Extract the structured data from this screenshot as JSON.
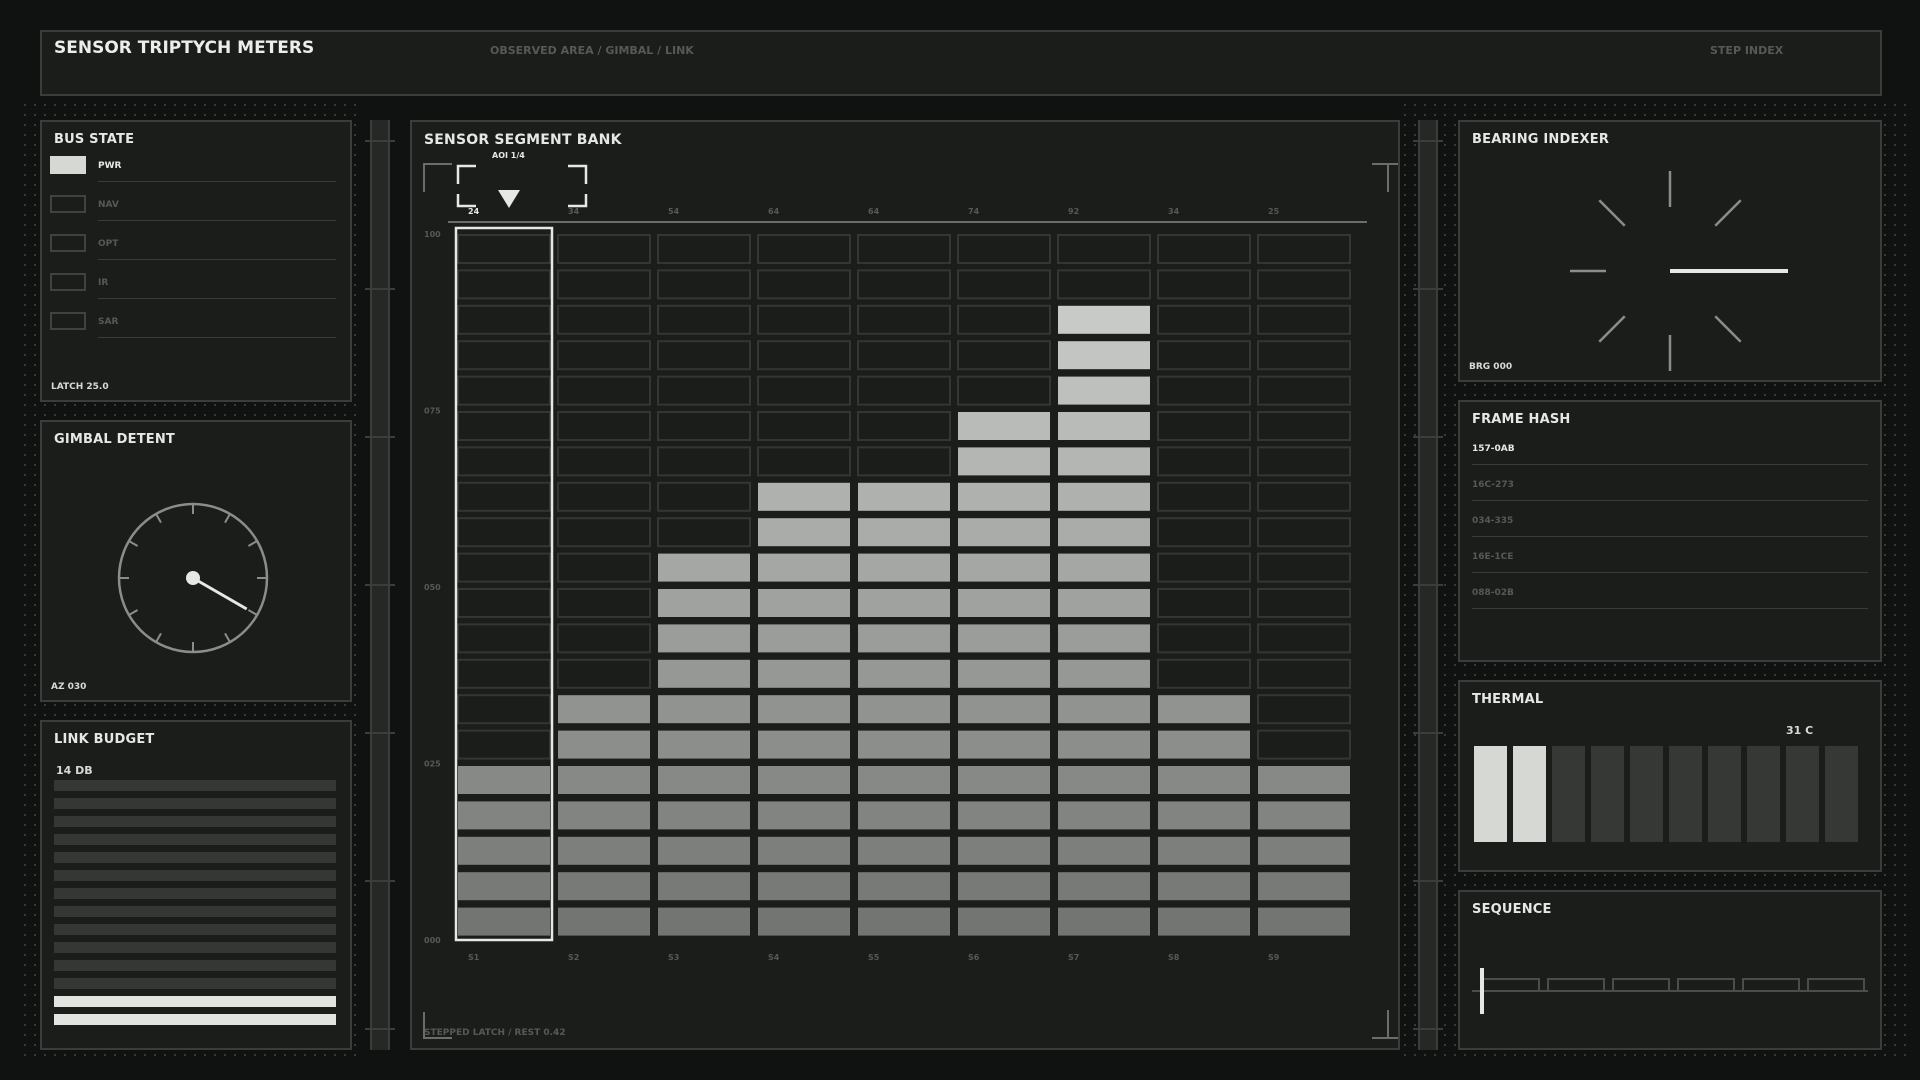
{
  "header": {
    "title": "SENSOR TRIPTYCH METERS",
    "breadcrumb": "OBSERVED AREA / GIMBAL / LINK",
    "right_label": "STEP INDEX"
  },
  "bus_state": {
    "title": "BUS STATE",
    "items": [
      {
        "label": "PWR",
        "active": true
      },
      {
        "label": "NAV",
        "active": false
      },
      {
        "label": "OPT",
        "active": false
      },
      {
        "label": "IR",
        "active": false
      },
      {
        "label": "SAR",
        "active": false
      }
    ],
    "footer": "LATCH 25.0"
  },
  "gimbal": {
    "title": "GIMBAL DETENT",
    "footer": "AZ 030",
    "angle_deg": 120
  },
  "link_budget": {
    "title": "LINK BUDGET",
    "value": "14 DB",
    "total_bars": 14,
    "lit_bars": 2
  },
  "segment_bank": {
    "title": "SENSOR SEGMENT BANK",
    "aoi": "AOI 1/4",
    "footer": "STEPPED LATCH / REST 0.42",
    "y_labels": [
      "100",
      "075",
      "050",
      "025",
      "000"
    ],
    "rows": 20,
    "channels": [
      {
        "name": "S1",
        "top": "24",
        "level": 5,
        "selected": true
      },
      {
        "name": "S2",
        "top": "34",
        "level": 7
      },
      {
        "name": "S3",
        "top": "54",
        "level": 11
      },
      {
        "name": "S4",
        "top": "64",
        "level": 13
      },
      {
        "name": "S5",
        "top": "64",
        "level": 13
      },
      {
        "name": "S6",
        "top": "74",
        "level": 15
      },
      {
        "name": "S7",
        "top": "92",
        "level": 18
      },
      {
        "name": "S8",
        "top": "34",
        "level": 7
      },
      {
        "name": "S9",
        "top": "25",
        "level": 5
      }
    ]
  },
  "bearing": {
    "title": "BEARING INDEXER",
    "footer": "BRG 000"
  },
  "frame_hash": {
    "title": "FRAME HASH",
    "items": [
      "157-0AB",
      "16C-273",
      "034-335",
      "16E-1CE",
      "088-02B"
    ]
  },
  "thermal": {
    "title": "THERMAL",
    "value": "31 C",
    "total_cells": 10,
    "lit_cells": 2
  },
  "sequence": {
    "title": "SEQUENCE",
    "steps": 6
  },
  "colors": {
    "bg": "#101211",
    "panel": "#1b1d1b",
    "border": "#3a3d3a",
    "text": "#e6e8e4",
    "dim": "#565955",
    "lit": "#d6d8d4"
  }
}
